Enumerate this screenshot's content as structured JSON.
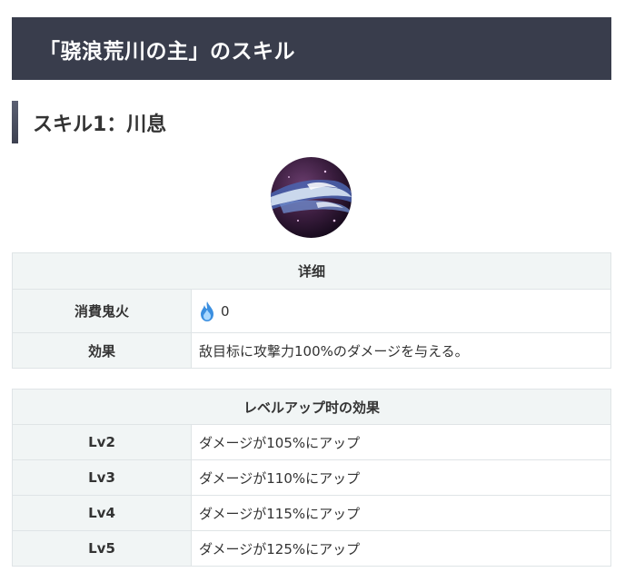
{
  "page_title": "「骁浪荒川の主」のスキル",
  "skill_heading": "スキル1：川息",
  "detail_table": {
    "caption": "详细",
    "rows": [
      {
        "label": "消費鬼火",
        "value": "0",
        "icon": "onibi-flame-icon"
      },
      {
        "label": "効果",
        "value": "敌目标に攻撃力100%のダメージを与える。"
      }
    ]
  },
  "level_table": {
    "caption": "レベルアップ时の効果",
    "rows": [
      {
        "label": "Lv2",
        "value": "ダメージが105%にアップ"
      },
      {
        "label": "Lv3",
        "value": "ダメージが110%にアップ"
      },
      {
        "label": "Lv4",
        "value": "ダメージが115%にアップ"
      },
      {
        "label": "Lv5",
        "value": "ダメージが125%にアップ"
      }
    ]
  },
  "colors": {
    "banner_bg": "#393d4c",
    "table_header_bg": "#f1f5f5",
    "table_border": "#dfe4e6",
    "onibi_blue": "#3b8fe0"
  }
}
